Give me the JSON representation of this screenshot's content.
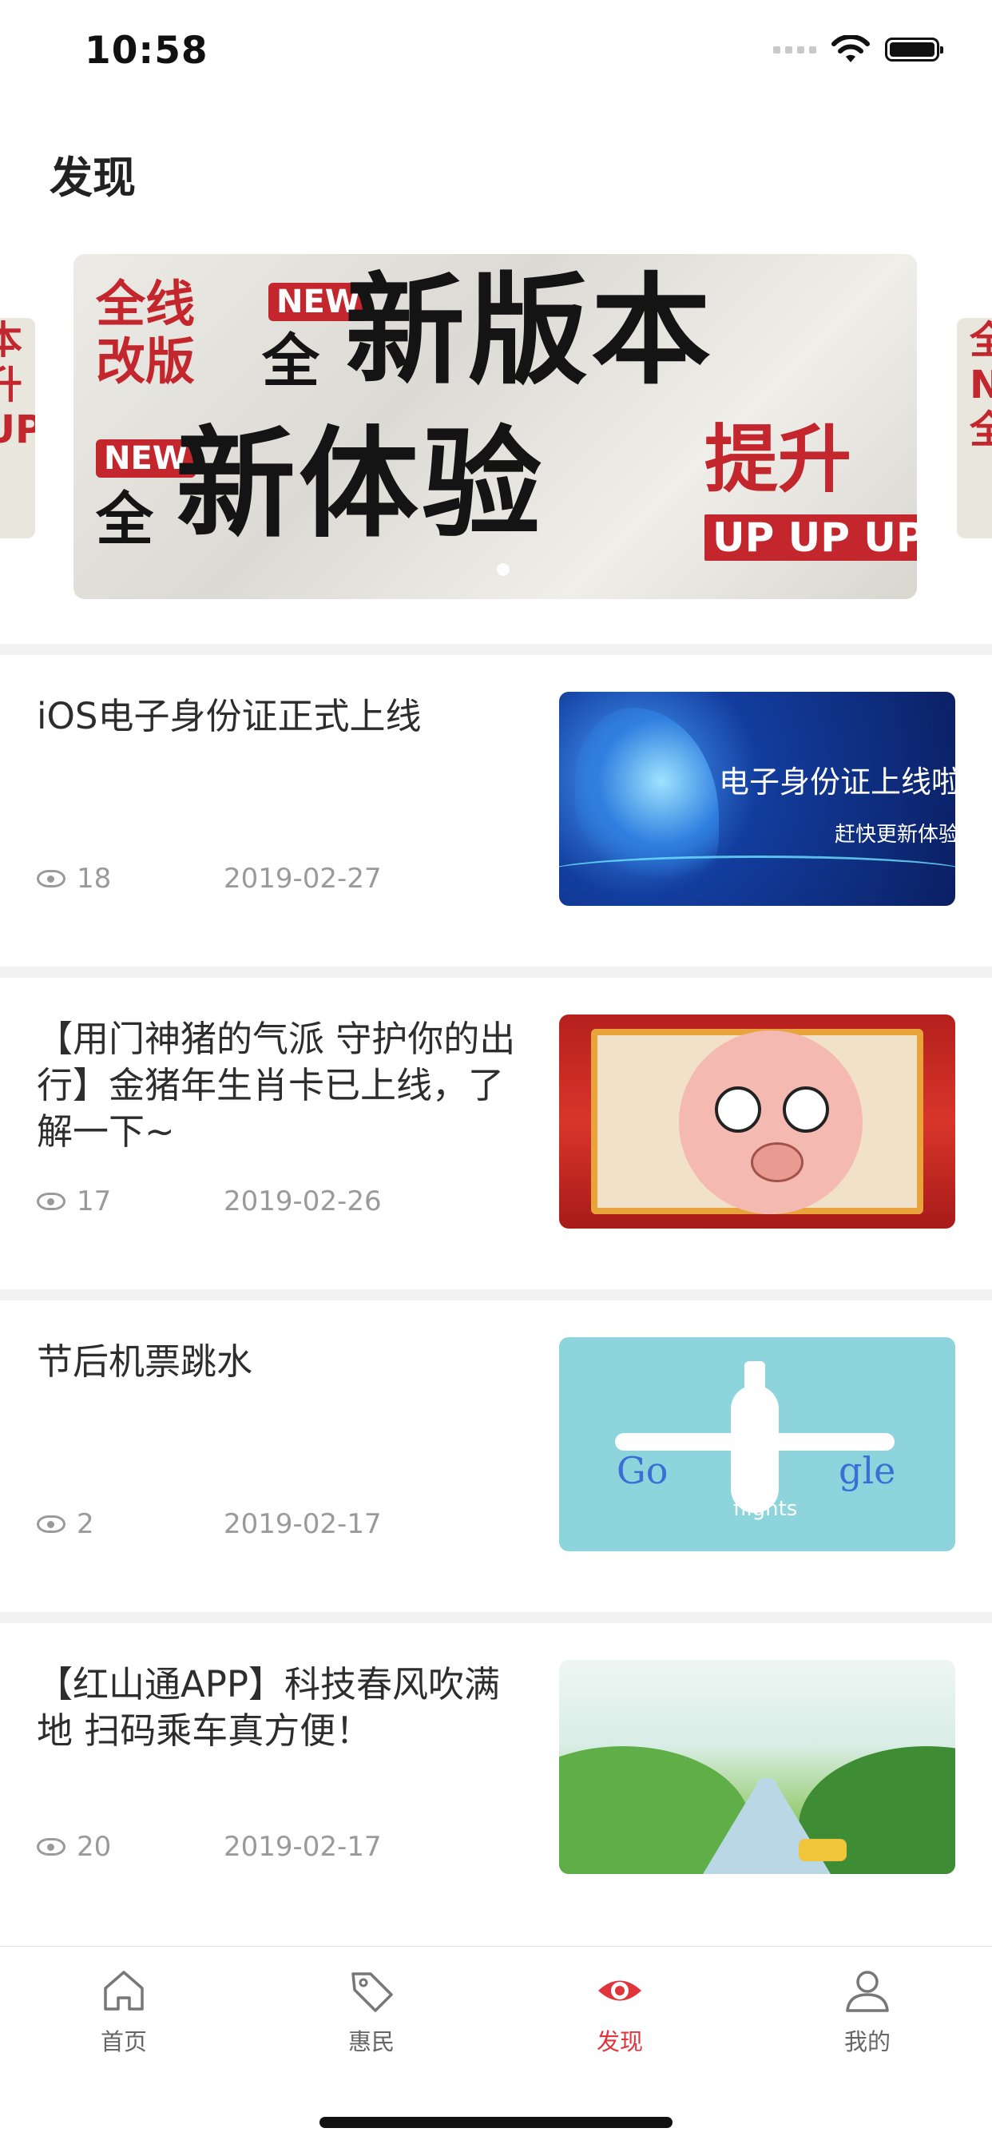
{
  "status_bar": {
    "time": "10:58"
  },
  "header": {
    "title": "发现"
  },
  "banner": {
    "lines": {
      "a1": "全线",
      "a2": "改版",
      "new1": "NEW",
      "quan1": "全",
      "big1": "新版本",
      "new2": "NEW",
      "quan2": "全",
      "big2": "新体验",
      "ti": "提升",
      "up": "UP UP UP"
    },
    "left_peek": "本\n升\nUP",
    "right_peek": "全\nNE\n全"
  },
  "news": [
    {
      "title": "iOS电子身份证正式上线",
      "views": "18",
      "date": "2019-02-27",
      "thumb_text": "电子身份证上线啦",
      "thumb_sub": "赶快更新体验"
    },
    {
      "title": "【用门神猪的气派 守护你的出行】金猪年生肖卡已上线，了解一下~",
      "views": "17",
      "date": "2019-02-26"
    },
    {
      "title": "节后机票跳水",
      "views": "2",
      "date": "2019-02-17",
      "thumb_g1": "Go",
      "thumb_g2": "gle",
      "thumb_sub": "flights"
    },
    {
      "title": "【红山通APP】科技春风吹满地 扫码乘车真方便！",
      "views": "20",
      "date": "2019-02-17"
    }
  ],
  "tabbar": {
    "items": [
      {
        "label": "首页",
        "icon": "home-icon"
      },
      {
        "label": "惠民",
        "icon": "tag-icon"
      },
      {
        "label": "发现",
        "icon": "eye-icon"
      },
      {
        "label": "我的",
        "icon": "user-icon"
      }
    ],
    "active_color": "#e0353b",
    "inactive_color": "#666666"
  }
}
